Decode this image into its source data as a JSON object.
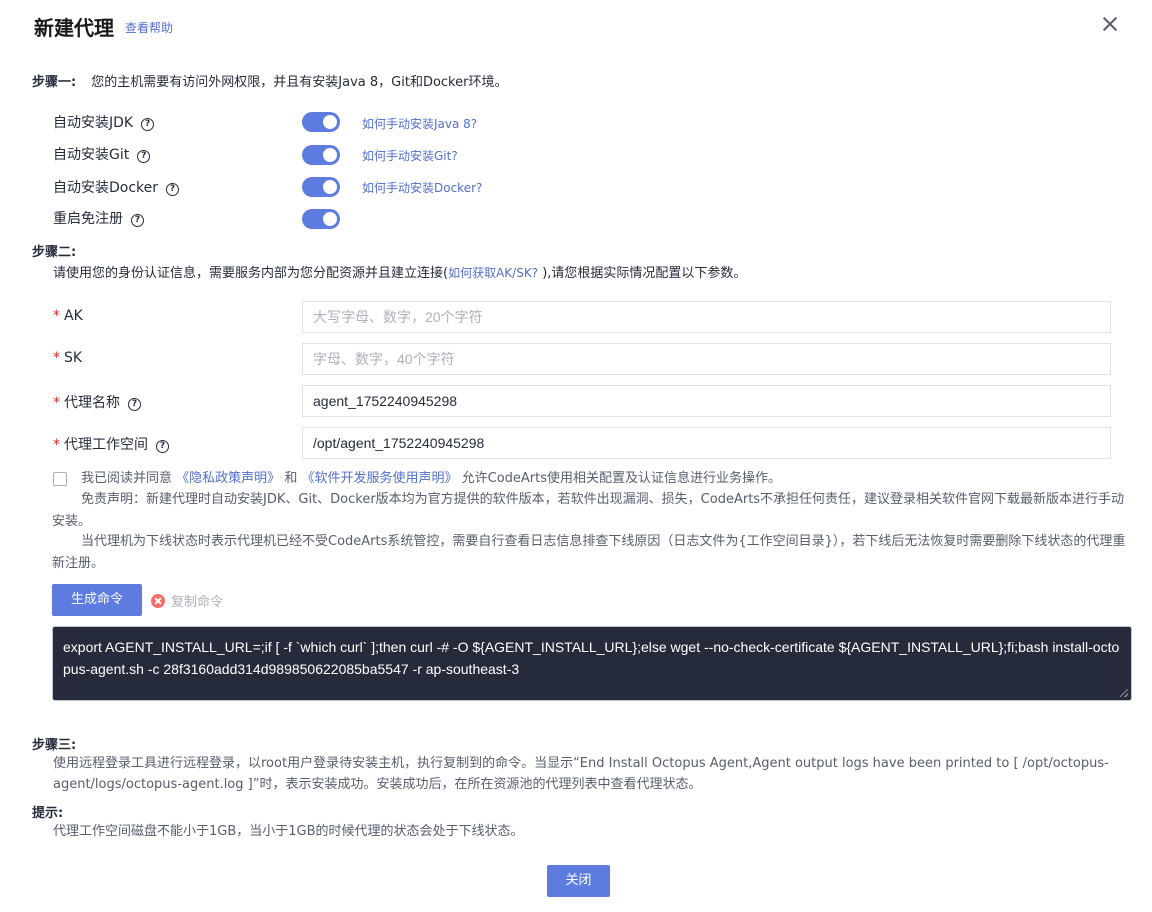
{
  "dialog": {
    "title": "新建代理",
    "help_link": "查看帮助"
  },
  "step1": {
    "label": "步骤一:",
    "text": "您的主机需要有访问外网权限，并且有安装Java 8，Git和Docker环境。",
    "toggles": [
      {
        "label": "自动安装JDK",
        "on": true,
        "link": "如何手动安装Java 8?"
      },
      {
        "label": "自动安装Git",
        "on": true,
        "link": "如何手动安装Git?"
      },
      {
        "label": "自动安装Docker",
        "on": true,
        "link": "如何手动安装Docker?"
      },
      {
        "label": "重启免注册",
        "on": true,
        "link": ""
      }
    ]
  },
  "step2": {
    "label": "步骤二:",
    "text_before": "请使用您的身份认证信息，需要服务内部为您分配资源并且建立连接(",
    "text_link": "如何获取AK/SK?",
    "text_after": " ),请您根据实际情况配置以下参数。",
    "fields": [
      {
        "label": "AK",
        "value": "",
        "placeholder": "大写字母、数字，20个字符"
      },
      {
        "label": "SK",
        "value": "",
        "placeholder": "字母、数字，40个字符"
      },
      {
        "label": "代理名称",
        "value": "agent_1752240945298",
        "placeholder": ""
      },
      {
        "label": "代理工作空间",
        "value": "/opt/agent_1752240945298",
        "placeholder": ""
      }
    ],
    "agreement_prefix": "我已阅读并同意",
    "privacy_link": "《隐私政策声明》",
    "and": "和",
    "service_link": "《软件开发服务使用声明》",
    "agreement_suffix": "允许CodeArts使用相关配置及认证信息进行业务操作。",
    "disclaimer1": "免责声明：新建代理时自动安装JDK、Git、Docker版本均为官方提供的软件版本，若软件出现漏洞、损失，CodeArts不承担任何责任，建议登录相关软件官网下载最新版本进行手动安装。",
    "disclaimer2": "当代理机为下线状态时表示代理机已经不受CodeArts系统管控，需要自行查看日志信息排查下线原因（日志文件为{工作空间目录}），若下线后无法恢复时需要删除下线状态的代理重新注册。",
    "generate_btn": "生成命令",
    "copy_btn": "复制命令",
    "command": "export AGENT_INSTALL_URL=;if [ -f `which curl` ];then curl -# -O ${AGENT_INSTALL_URL};else wget --no-check-certificate ${AGENT_INSTALL_URL};fi;bash install-octopus-agent.sh -c 28f3160add314d989850622085ba5547 -r ap-southeast-3"
  },
  "step3": {
    "label": "步骤三:",
    "text": "使用远程登录工具进行远程登录，以root用户登录待安装主机，执行复制到的命令。当显示“End Install Octopus Agent,Agent output logs have been printed to [ /opt/octopus-agent/logs/octopus-agent.log ]”时，表示安装成功。安装成功后，在所在资源池的代理列表中查看代理状态。"
  },
  "tip": {
    "label": "提示:",
    "text": "代理工作空间磁盘不能小于1GB，当小于1GB的时候代理的状态会处于下线状态。"
  },
  "footer": {
    "close_btn": "关闭"
  },
  "colors": {
    "accent": "#5e7ce0",
    "link": "#526ecc",
    "required": "#e02b2b",
    "code_bg": "#252b3a"
  }
}
